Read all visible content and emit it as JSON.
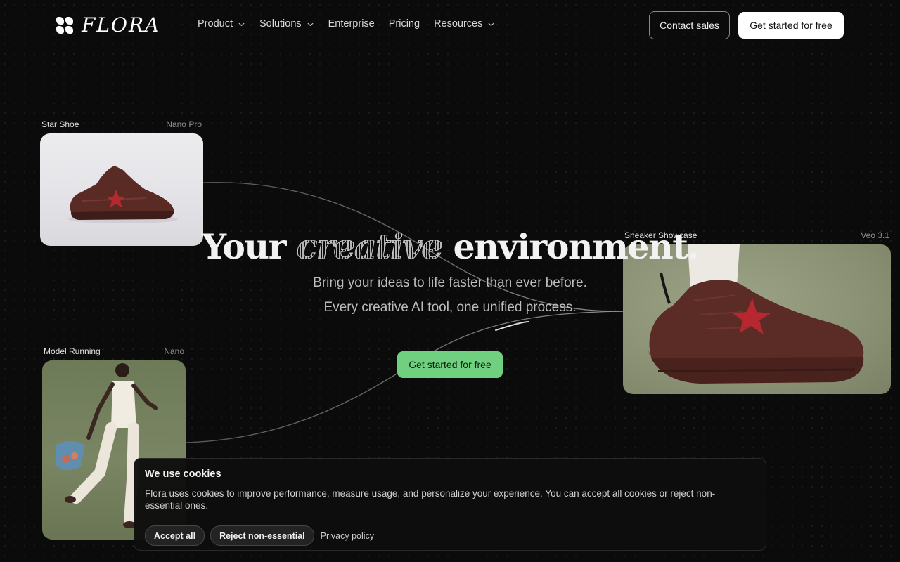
{
  "brand": {
    "name": "FLORA"
  },
  "nav": {
    "links": [
      {
        "label": "Product",
        "has_dropdown": true
      },
      {
        "label": "Solutions",
        "has_dropdown": true
      },
      {
        "label": "Enterprise",
        "has_dropdown": false
      },
      {
        "label": "Pricing",
        "has_dropdown": false
      },
      {
        "label": "Resources",
        "has_dropdown": true
      }
    ],
    "contact_label": "Contact sales",
    "cta_label": "Get started for free"
  },
  "cards": [
    {
      "title": "Star Shoe",
      "model": "Nano Pro"
    },
    {
      "title": "Model Running",
      "model": "Nano"
    },
    {
      "title": "Sneaker Showcase",
      "model": "Veo 3.1"
    }
  ],
  "hero": {
    "title_before": "Your",
    "title_emphasis": "creative",
    "title_after": "environment.",
    "subtitle_line1": "Bring your ideas to life faster than ever before.",
    "subtitle_line2": "Every creative AI tool, one unified process.",
    "cta_label": "Get started for free"
  },
  "cookie": {
    "title": "We use cookies",
    "text": "Flora uses cookies to improve performance, measure usage, and personalize your experience. You can accept all cookies or reject non-essential ones.",
    "accept_label": "Accept all",
    "reject_label": "Reject non-essential",
    "policy_label": "Privacy policy"
  },
  "colors": {
    "background": "#0b0b0b",
    "accent_green": "#6fd07f",
    "text_primary": "#f2f2f2",
    "text_muted": "#bdbdbd"
  },
  "icons": [
    "flora-logo-icon",
    "chevron-down-icon"
  ]
}
